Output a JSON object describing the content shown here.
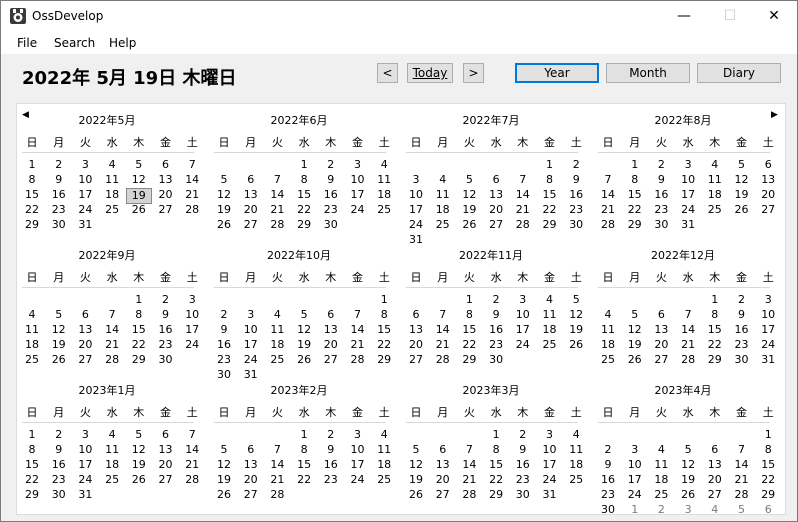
{
  "window": {
    "title": "OssDevelop",
    "min_glyph": "—",
    "max_glyph": "☐",
    "close_glyph": "✕"
  },
  "menu": [
    "File",
    "Search",
    "Help"
  ],
  "header": {
    "date_title": "2022年 5月 19日 木曜日"
  },
  "toolbar": {
    "prev": "<",
    "today": "Today",
    "next": ">",
    "year": "Year",
    "month": "Month",
    "diary": "Diary",
    "active_view": "Year"
  },
  "nav": {
    "prev_arrow": "◀",
    "next_arrow": "▶"
  },
  "weekdays": [
    "日",
    "月",
    "火",
    "水",
    "木",
    "金",
    "土"
  ],
  "selected": {
    "year": 2022,
    "month": 5,
    "day": 19
  },
  "months": [
    {
      "title": "2022年5月",
      "year": 2022,
      "month": 5
    },
    {
      "title": "2022年6月",
      "year": 2022,
      "month": 6
    },
    {
      "title": "2022年7月",
      "year": 2022,
      "month": 7
    },
    {
      "title": "2022年8月",
      "year": 2022,
      "month": 8
    },
    {
      "title": "2022年9月",
      "year": 2022,
      "month": 9
    },
    {
      "title": "2022年10月",
      "year": 2022,
      "month": 10
    },
    {
      "title": "2022年11月",
      "year": 2022,
      "month": 11
    },
    {
      "title": "2022年12月",
      "year": 2022,
      "month": 12
    },
    {
      "title": "2023年1月",
      "year": 2023,
      "month": 1
    },
    {
      "title": "2023年2月",
      "year": 2023,
      "month": 2
    },
    {
      "title": "2023年3月",
      "year": 2023,
      "month": 3
    },
    {
      "title": "2023年4月",
      "year": 2023,
      "month": 4
    }
  ],
  "colors": {
    "accent": "#0078d7",
    "other_month": "#7a7a7a"
  }
}
